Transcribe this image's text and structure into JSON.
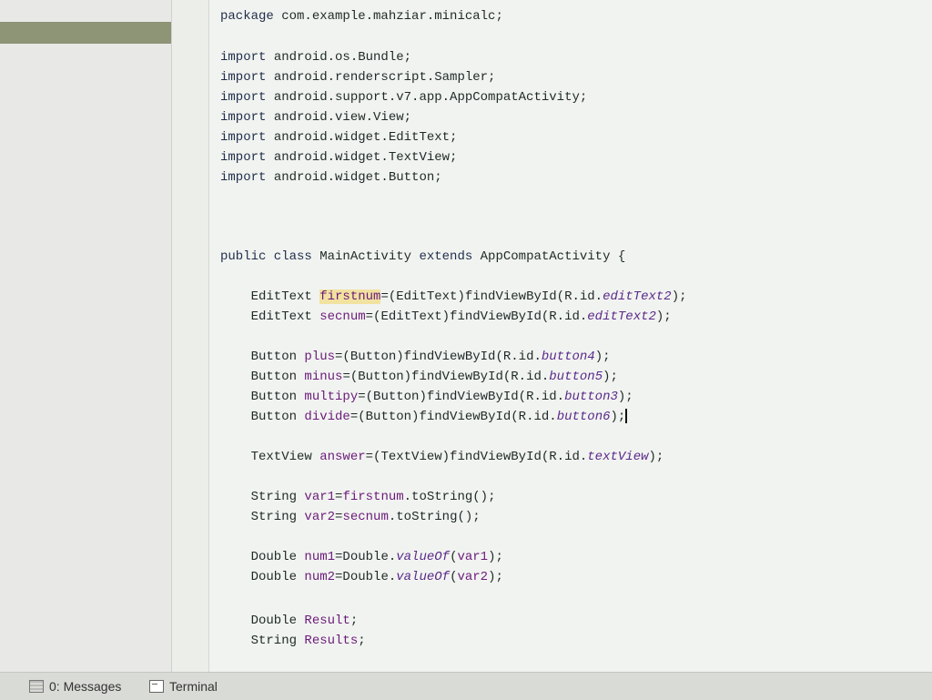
{
  "editor": {
    "lines": [
      [
        {
          "t": "package ",
          "c": "kw"
        },
        {
          "t": "com.example.mahziar.minicalc;"
        }
      ],
      [],
      [
        {
          "t": "import ",
          "c": "kw"
        },
        {
          "t": "android.os.Bundle;"
        }
      ],
      [
        {
          "t": "import ",
          "c": "kw"
        },
        {
          "t": "android.renderscript.Sampler;"
        }
      ],
      [
        {
          "t": "import ",
          "c": "kw"
        },
        {
          "t": "android.support.v7.app.AppCompatActivity;"
        }
      ],
      [
        {
          "t": "import ",
          "c": "kw"
        },
        {
          "t": "android.view.View;"
        }
      ],
      [
        {
          "t": "import ",
          "c": "kw"
        },
        {
          "t": "android.widget.EditText;"
        }
      ],
      [
        {
          "t": "import ",
          "c": "kw"
        },
        {
          "t": "android.widget.TextView;"
        }
      ],
      [
        {
          "t": "import ",
          "c": "kw"
        },
        {
          "t": "android.widget.Button;"
        }
      ],
      [],
      [
        {
          "t": "public class ",
          "c": "kw"
        },
        {
          "t": "MainActivity "
        },
        {
          "t": "extends ",
          "c": "kw"
        },
        {
          "t": "AppCompatActivity {"
        }
      ],
      [],
      [
        {
          "t": "    EditText "
        },
        {
          "t": "firstnum",
          "c": "field hl"
        },
        {
          "t": "=(EditText)findViewById(R.id."
        },
        {
          "t": "editText2",
          "c": "italic"
        },
        {
          "t": ");"
        }
      ],
      [
        {
          "t": "    EditText "
        },
        {
          "t": "secnum",
          "c": "field"
        },
        {
          "t": "=(EditText)findViewById(R.id."
        },
        {
          "t": "editText2",
          "c": "italic"
        },
        {
          "t": ");"
        }
      ],
      [],
      [
        {
          "t": "    Button "
        },
        {
          "t": "plus",
          "c": "field"
        },
        {
          "t": "=(Button)findViewById(R.id."
        },
        {
          "t": "button4",
          "c": "italic"
        },
        {
          "t": ");"
        }
      ],
      [
        {
          "t": "    Button "
        },
        {
          "t": "minus",
          "c": "field"
        },
        {
          "t": "=(Button)findViewById(R.id."
        },
        {
          "t": "button5",
          "c": "italic"
        },
        {
          "t": ");"
        }
      ],
      [
        {
          "t": "    Button "
        },
        {
          "t": "multipy",
          "c": "field"
        },
        {
          "t": "=(Button)findViewById(R.id."
        },
        {
          "t": "button3",
          "c": "italic"
        },
        {
          "t": ");"
        }
      ],
      [
        {
          "t": "    Button "
        },
        {
          "t": "divide",
          "c": "field"
        },
        {
          "t": "=(Button)findViewById(R.id."
        },
        {
          "t": "button6",
          "c": "italic"
        },
        {
          "t": ");"
        },
        {
          "cursor": true
        }
      ],
      [],
      [
        {
          "t": "    TextView "
        },
        {
          "t": "answer",
          "c": "field"
        },
        {
          "t": "=(TextView)findViewById(R.id."
        },
        {
          "t": "textView",
          "c": "italic"
        },
        {
          "t": ");"
        }
      ],
      [],
      [
        {
          "t": "    String "
        },
        {
          "t": "var1",
          "c": "field"
        },
        {
          "t": "="
        },
        {
          "t": "firstnum",
          "c": "field"
        },
        {
          "t": ".toString();"
        }
      ],
      [
        {
          "t": "    String "
        },
        {
          "t": "var2",
          "c": "field"
        },
        {
          "t": "="
        },
        {
          "t": "secnum",
          "c": "field"
        },
        {
          "t": ".toString();"
        }
      ],
      [],
      [
        {
          "t": "    Double "
        },
        {
          "t": "num1",
          "c": "field"
        },
        {
          "t": "=Double."
        },
        {
          "t": "valueOf",
          "c": "italic"
        },
        {
          "t": "("
        },
        {
          "t": "var1",
          "c": "field"
        },
        {
          "t": ");"
        }
      ],
      [
        {
          "t": "    Double "
        },
        {
          "t": "num2",
          "c": "field"
        },
        {
          "t": "=Double."
        },
        {
          "t": "valueOf",
          "c": "italic"
        },
        {
          "t": "("
        },
        {
          "t": "var2",
          "c": "field"
        },
        {
          "t": ");"
        }
      ],
      [],
      [
        {
          "t": "    Double "
        },
        {
          "t": "Result",
          "c": "field"
        },
        {
          "t": ";"
        }
      ],
      [
        {
          "t": "    String "
        },
        {
          "t": "Results",
          "c": "field"
        },
        {
          "t": ";"
        }
      ]
    ]
  },
  "bottom_bar": {
    "messages_label": "0: Messages",
    "terminal_label": "Terminal"
  }
}
